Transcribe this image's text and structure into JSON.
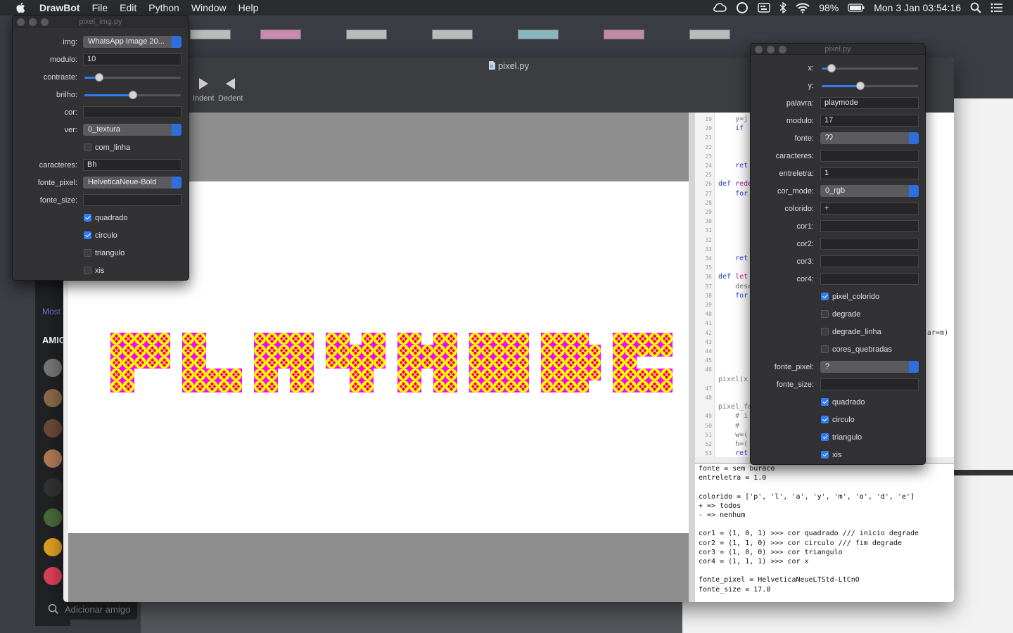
{
  "menubar": {
    "app": "DrawBot",
    "items": [
      "File",
      "Edit",
      "Python",
      "Window",
      "Help"
    ],
    "battery": "98%",
    "datetime": "Mon 3 Jan  03:54:16"
  },
  "main_window": {
    "title": "pixel.py",
    "toolbar": {
      "indent": "Indent",
      "dedent": "Dedent"
    },
    "canvas": {
      "letters": [
        "p",
        "l",
        "a",
        "y",
        "m",
        "o",
        "d",
        "e"
      ],
      "pattern_colors": {
        "square": "#ff00ff",
        "circle": "#ffff00",
        "triangle": "#ff0000",
        "x": "#ffffff"
      }
    },
    "code_lines": [
      {
        "n": "19",
        "t": "    y=j"
      },
      {
        "n": "20",
        "t": "    if "
      },
      {
        "n": "21",
        "t": ""
      },
      {
        "n": "22",
        "t": ""
      },
      {
        "n": "23",
        "t": ""
      },
      {
        "n": "24",
        "t": "    ret"
      },
      {
        "n": "25",
        "t": ""
      },
      {
        "n": "26",
        "t": "def rede"
      },
      {
        "n": "27",
        "t": "    for"
      },
      {
        "n": "28",
        "t": ""
      },
      {
        "n": "29",
        "t": ""
      },
      {
        "n": "30",
        "t": ""
      },
      {
        "n": "31",
        "t": ""
      },
      {
        "n": "32",
        "t": ""
      },
      {
        "n": "33",
        "t": ""
      },
      {
        "n": "34",
        "t": "    ret"
      },
      {
        "n": "35",
        "t": ""
      },
      {
        "n": "36",
        "t": "def let"
      },
      {
        "n": "37",
        "t": "    dese"
      },
      {
        "n": "38",
        "t": "    for"
      },
      {
        "n": "39",
        "t": ""
      },
      {
        "n": "40",
        "t": ""
      },
      {
        "n": "41",
        "t": ""
      },
      {
        "n": "42",
        "t": ""
      },
      {
        "n": "43",
        "t": ""
      },
      {
        "n": "44",
        "t": ""
      },
      {
        "n": "45",
        "t": ""
      },
      {
        "n": "46",
        "t": ""
      },
      {
        "n": "",
        "t": "pixel(x"
      },
      {
        "n": "47",
        "t": ""
      },
      {
        "n": "48",
        "t": ""
      },
      {
        "n": "",
        "t": "pixel_fo"
      },
      {
        "n": "49",
        "t": "    # i"
      },
      {
        "n": "50",
        "t": "    #"
      },
      {
        "n": "51",
        "t": "    w=("
      },
      {
        "n": "52",
        "t": "    h=("
      },
      {
        "n": "53",
        "t": "    ret"
      }
    ],
    "code_fragment_right": "ar=m)",
    "output_lines": [
      "fonte = sem buraco",
      "entreletra = 1.0",
      "",
      "colorido = ['p', 'l', 'a', 'y', 'm', 'o', 'd', 'e']",
      "+ => todos",
      "- => nenhum",
      "",
      "cor1 = (1, 0, 1) >>> cor quadrado /// inicio degrade",
      "cor2 = (1, 1, 0) >>> cor circulo /// fim degrade",
      "cor3 = (1, 0, 0) >>> cor triangulo",
      "cor4 = (1, 1, 1) >>> cor x",
      "",
      "fonte_pixel = HelveticaNeueLTStd-LtCnO",
      "fonte_size = 17.0"
    ]
  },
  "panel_left": {
    "title": "pixel_img.py",
    "img_label": "img:",
    "img_value": "WhatsApp Image 20...",
    "modulo_label": "modulo:",
    "modulo_value": "10",
    "contraste_label": "contraste:",
    "contraste_value": 0.15,
    "brilho_label": "brilho:",
    "brilho_value": 0.5,
    "cor_label": "cor:",
    "cor_value": "",
    "ver_label": "ver:",
    "ver_value": "0_textura",
    "com_linha_label": "com_linha",
    "com_linha_checked": false,
    "caracteres_label": "caracteres:",
    "caracteres_value": "Bh",
    "fonte_pixel_label": "fonte_pixel:",
    "fonte_pixel_value": "HelveticaNeue-Bold",
    "fonte_size_label": "fonte_size:",
    "fonte_size_value": "",
    "quadrado_label": "quadrado",
    "quadrado_checked": true,
    "circulo_label": "circulo",
    "circulo_checked": true,
    "triangulo_label": "triangulo",
    "triangulo_checked": false,
    "xis_label": "xis",
    "xis_checked": false
  },
  "panel_right": {
    "title": "pixel.py",
    "x_label": "x:",
    "x_value": 0.1,
    "y_label": "y:",
    "y_value": 0.4,
    "palavra_label": "palavra:",
    "palavra_value": "playmode",
    "modulo_label": "modulo:",
    "modulo_value": "17",
    "fonte_label": "fonte:",
    "fonte_value": "ʔʔ",
    "caracteres_label": "caracteres:",
    "caracteres_value": "",
    "entreletra_label": "entreletra:",
    "entreletra_value": "1",
    "cor_mode_label": "cor_mode:",
    "cor_mode_value": "0_rgb",
    "colorido_label": "colorido:",
    "colorido_value": "+",
    "cor1_label": "cor1:",
    "cor2_label": "cor2:",
    "cor3_label": "cor3:",
    "cor4_label": "cor4:",
    "pixel_colorido_label": "pixel_colorido",
    "pixel_colorido_checked": true,
    "degrade_label": "degrade",
    "degrade_checked": false,
    "degrade_linha_label": "degrade_linha",
    "degrade_linha_checked": false,
    "cores_quebradas_label": "cores_quebradas",
    "cores_quebradas_checked": false,
    "fonte_pixel_label": "fonte_pixel:",
    "fonte_pixel_value": "?",
    "fonte_size_label": "fonte_size:",
    "fonte_size_value": "",
    "quadrado_label": "quadrado",
    "quadrado_checked": true,
    "circulo_label": "circulo",
    "circulo_checked": true,
    "triangulo_label": "triangulo",
    "triangulo_checked": true,
    "xis_label": "xis",
    "xis_checked": true
  },
  "background": {
    "discord_labels": [
      "Most",
      "AMIG"
    ],
    "discord_search_placeholder": "Adicionar amigo"
  }
}
